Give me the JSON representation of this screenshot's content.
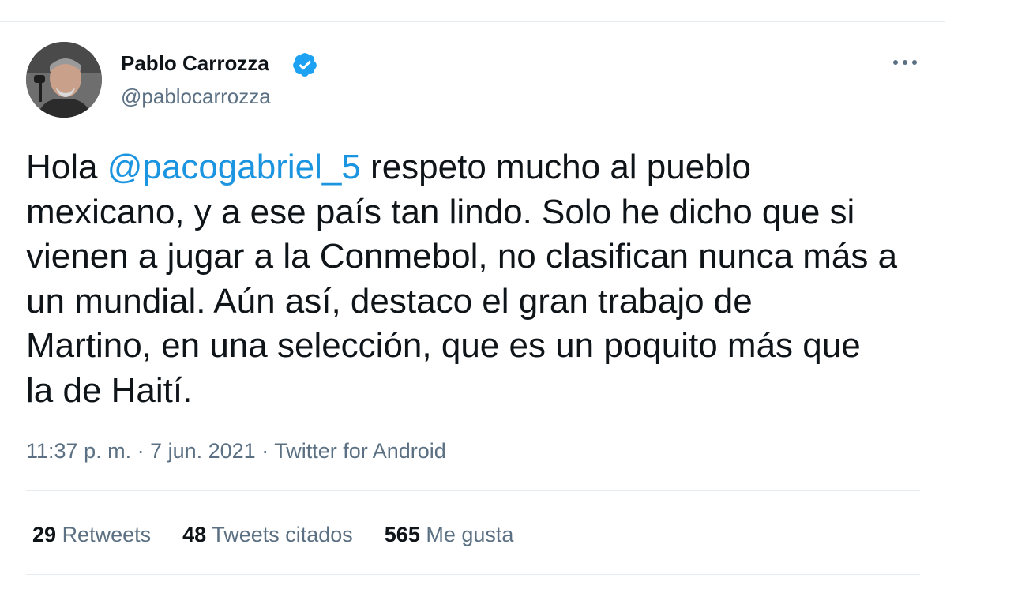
{
  "author": {
    "display_name": "Pablo Carrozza",
    "handle": "@pablocarrozza",
    "verified_icon": "verified-badge-icon",
    "avatar_icon": "avatar"
  },
  "tweet": {
    "lines": [
      {
        "before": "Hola ",
        "mention": "@pacogabriel_5",
        "after": " respeto mucho al pueblo"
      },
      {
        "text": "mexicano, y a ese país tan lindo. Solo he dicho que si"
      },
      {
        "text": "vienen a jugar a la Conmebol, no clasifican nunca más a"
      },
      {
        "text": "un mundial. Aún así, destaco el gran trabajo de"
      },
      {
        "text": "Martino, en una selección, que es un poquito más que"
      },
      {
        "text": "la de Haití."
      }
    ]
  },
  "meta": {
    "time": "11:37 p. m.",
    "sep1": " · ",
    "date": "7 jun. 2021",
    "sep2": " · ",
    "source": "Twitter for Android"
  },
  "stats": {
    "retweets": {
      "count": "29",
      "label": "Retweets"
    },
    "quotes": {
      "count": "48",
      "label": "Tweets citados"
    },
    "likes": {
      "count": "565",
      "label": "Me gusta"
    }
  },
  "colors": {
    "link": "#1b95e0",
    "secondary_text": "#5b7083",
    "divider": "#e6ecf0",
    "verified": "#1da1f2"
  }
}
